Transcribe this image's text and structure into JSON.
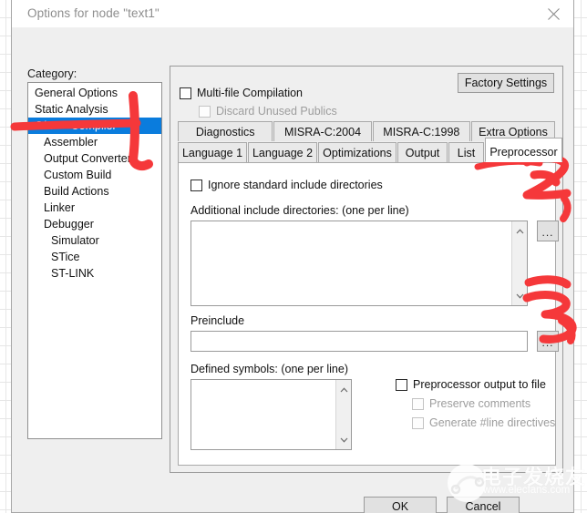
{
  "window": {
    "title": "Options for node \"text1\"",
    "close_icon": "close-icon"
  },
  "left": {
    "category_label": "Category:",
    "categories": [
      {
        "label": "General Options",
        "indent": false,
        "selected": false
      },
      {
        "label": "Static Analysis",
        "indent": false,
        "selected": false
      },
      {
        "label": "C/C++ Compiler",
        "indent": false,
        "selected": true
      },
      {
        "label": "Assembler",
        "indent": true,
        "selected": false
      },
      {
        "label": "Output Converter",
        "indent": true,
        "selected": false
      },
      {
        "label": "Custom Build",
        "indent": true,
        "selected": false
      },
      {
        "label": "Build Actions",
        "indent": true,
        "selected": false
      },
      {
        "label": "Linker",
        "indent": true,
        "selected": false
      },
      {
        "label": "Debugger",
        "indent": true,
        "selected": false
      },
      {
        "label": "Simulator",
        "indent": true,
        "selected": false,
        "extra": true
      },
      {
        "label": "STice",
        "indent": true,
        "selected": false,
        "extra": true
      },
      {
        "label": "ST-LINK",
        "indent": true,
        "selected": false,
        "extra": true
      }
    ]
  },
  "panel": {
    "factory_settings": "Factory Settings",
    "multifile": {
      "label": "Multi-file Compilation",
      "checked": false,
      "disabled": false
    },
    "discard": {
      "label": "Discard Unused Publics",
      "checked": false,
      "disabled": true
    },
    "tabs_row1": [
      {
        "label": "Diagnostics",
        "selected": false
      },
      {
        "label": "MISRA-C:2004",
        "selected": false
      },
      {
        "label": "MISRA-C:1998",
        "selected": false
      },
      {
        "label": "Extra Options",
        "selected": false
      }
    ],
    "tabs_row2": [
      {
        "label": "Language 1",
        "selected": false
      },
      {
        "label": "Language 2",
        "selected": false
      },
      {
        "label": "Optimizations",
        "selected": false
      },
      {
        "label": "Output",
        "selected": false
      },
      {
        "label": "List",
        "selected": false
      },
      {
        "label": "Preprocessor",
        "selected": true
      }
    ],
    "preprocessor": {
      "ignore_std_include": {
        "label": "Ignore standard include directories",
        "checked": false
      },
      "additional_include_label": "Additional include directories: (one per line)",
      "additional_include_value": "",
      "additional_include_browse": "...",
      "preinclude_label": "Preinclude",
      "preinclude_value": "",
      "preinclude_browse": "...",
      "defined_symbols_label": "Defined symbols: (one per line)",
      "defined_symbols_value": "",
      "output_to_file": {
        "label": "Preprocessor output to file",
        "checked": false,
        "disabled": false
      },
      "preserve_comments": {
        "label": "Preserve comments",
        "checked": false,
        "disabled": true
      },
      "generate_line_directives": {
        "label": "Generate #line directives",
        "checked": false,
        "disabled": true
      }
    }
  },
  "footer": {
    "ok": "OK",
    "cancel": "Cancel"
  },
  "annotations": {
    "color": "#f5383a",
    "marks": [
      {
        "name": "mark-1",
        "text": "1"
      },
      {
        "name": "mark-2",
        "text": "2,"
      },
      {
        "name": "mark-3",
        "text": "3,"
      }
    ]
  },
  "watermark": {
    "cn": "电子发烧友",
    "url": "www.elecfans.com"
  }
}
